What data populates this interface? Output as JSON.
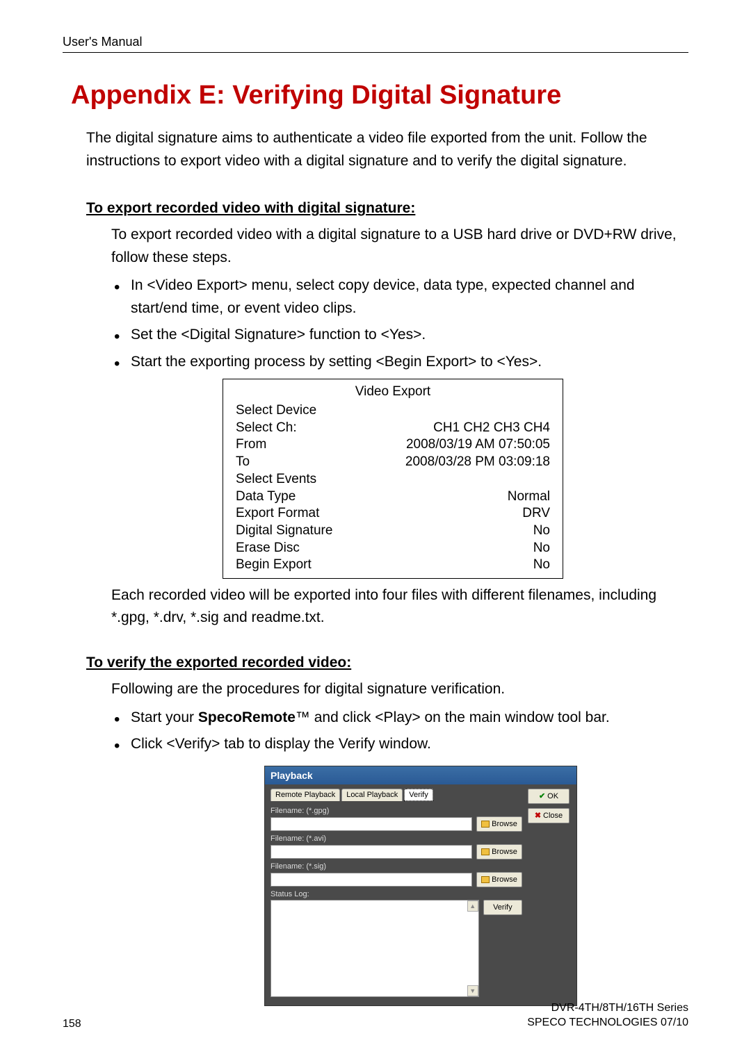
{
  "header": "User's Manual",
  "title": "Appendix E: Verifying Digital Signature",
  "intro": "The digital signature aims to authenticate a video file exported from the unit. Follow the instructions to export video with a digital signature and to verify the digital signature.",
  "section1": {
    "heading": "To export recorded video with digital signature:",
    "lead": "To export recorded video with a digital signature to a USB hard drive or DVD+RW drive, follow these steps.",
    "bullets": [
      "In <Video Export> menu, select copy device, data type, expected channel and start/end time, or event video clips.",
      "Set the <Digital Signature> function to <Yes>.",
      "Start the exporting process by setting <Begin Export> to <Yes>."
    ],
    "after": "Each recorded video will be exported into four files with different filenames, including *.gpg, *.drv, *.sig and readme.txt."
  },
  "menu": {
    "title": "Video Export",
    "rows": [
      {
        "left": "Select Device",
        "right": ""
      },
      {
        "left": "Select Ch:",
        "right": "CH1 CH2 CH3 CH4"
      },
      {
        "left": "From",
        "right": "2008/03/19 AM 07:50:05"
      },
      {
        "left": "To",
        "right": "2008/03/28 PM 03:09:18"
      },
      {
        "left": "Select Events",
        "right": ""
      },
      {
        "left": "Data Type",
        "right": "Normal"
      },
      {
        "left": "Export Format",
        "right": "DRV"
      },
      {
        "left": "Digital Signature",
        "right": "No"
      },
      {
        "left": "Erase Disc",
        "right": "No"
      },
      {
        "left": "Begin Export",
        "right": "No"
      }
    ]
  },
  "section2": {
    "heading": "To verify the exported recorded video:",
    "lead": "Following are the procedures for digital signature verification.",
    "bullets_pre": "Start your ",
    "bullets_bold": "SpecoRemote",
    "bullets_post": "™ and click <Play> on the main window tool bar.",
    "bullet2": "Click <Verify> tab to display the Verify window."
  },
  "dialog": {
    "title": "Playback",
    "tabs": [
      "Remote Playback",
      "Local Playback",
      "Verify"
    ],
    "file1_label": "Filename: (*.gpg)",
    "file2_label": "Filename: (*.avi)",
    "file3_label": "Filename: (*.sig)",
    "browse": "Browse",
    "status_label": "Status Log:",
    "verify": "Verify",
    "ok": "OK",
    "close": "Close"
  },
  "footer": {
    "page": "158",
    "series": "DVR-4TH/8TH/16TH Series",
    "company": "SPECO TECHNOLOGIES 07/10"
  }
}
